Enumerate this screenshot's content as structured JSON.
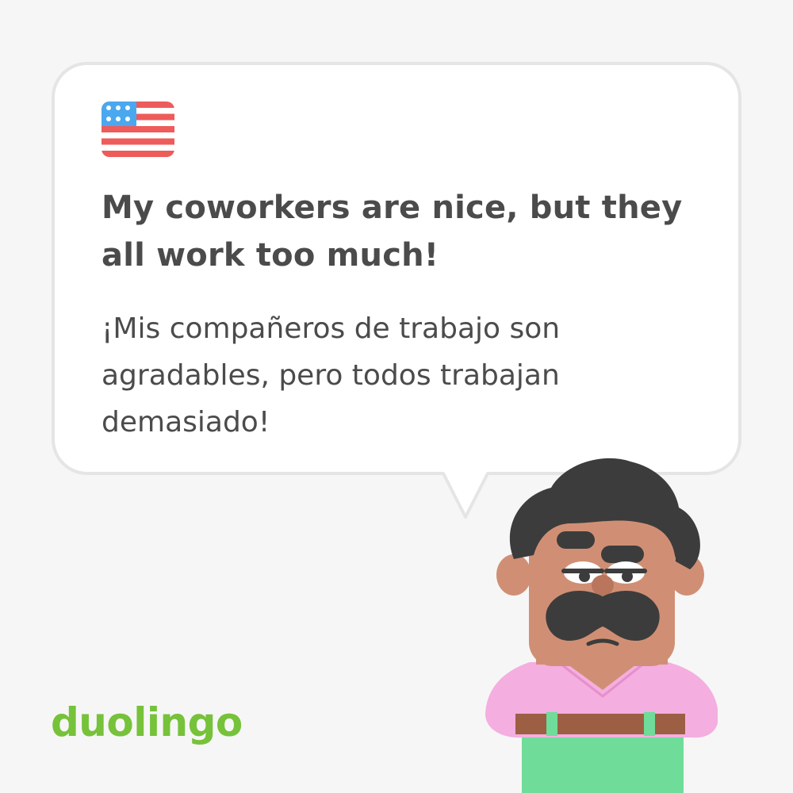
{
  "card": {
    "flag_icon": "us-flag-icon",
    "english_text": "My coworkers are nice, but they all work too much!",
    "spanish_text": "¡Mis compañeros de trabajo son agradables, pero todos trabajan demasiado!"
  },
  "brand": {
    "logo_text": "duolingo",
    "logo_color": "#76c23a"
  },
  "character": {
    "icon": "mustached-man-character",
    "skin_color": "#d08f74",
    "hair_color": "#3c3c3c",
    "shirt_color": "#f4aee0",
    "pants_color": "#6fdc99",
    "belt_color": "#9c5f43"
  },
  "colors": {
    "background": "#f6f6f6",
    "bubble_fill": "#ffffff",
    "bubble_border": "#e5e5e5",
    "text": "#4b4b4b"
  }
}
